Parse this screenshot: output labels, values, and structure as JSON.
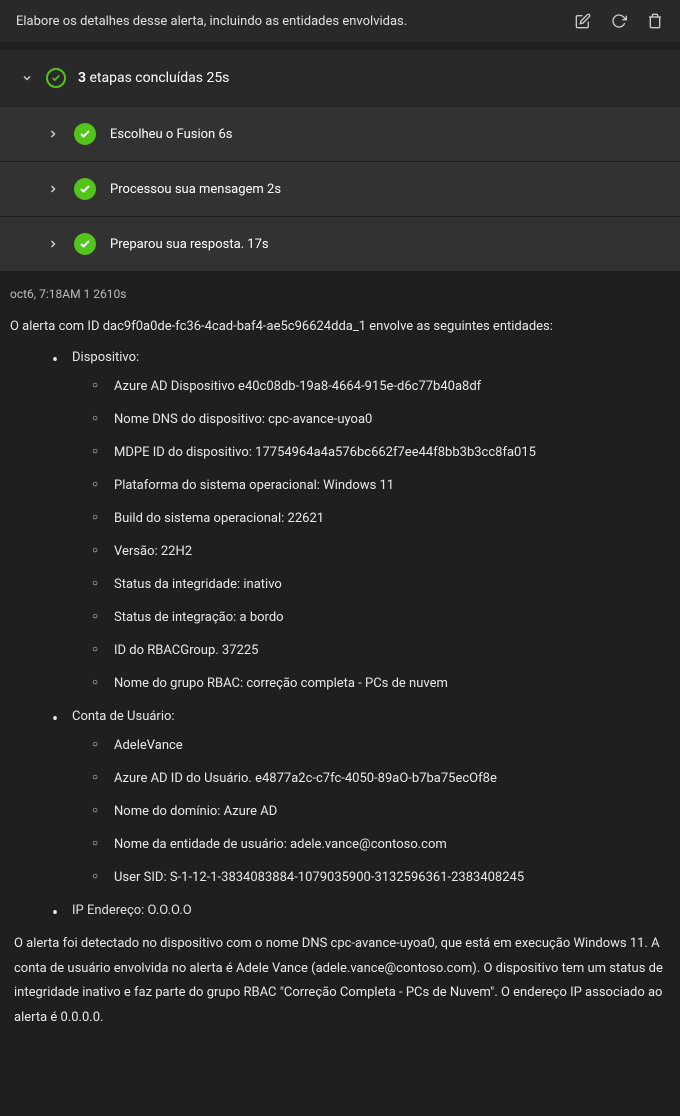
{
  "header": {
    "prompt": "Elabore os detalhes desse alerta, incluindo as entidades envolvidas."
  },
  "steps": {
    "summary_count": "3",
    "summary_label": "etapas concluídas 25s",
    "items": [
      {
        "label": "Escolheu o Fusion 6s"
      },
      {
        "label": "Processou sua mensagem 2s"
      },
      {
        "label": "Preparou sua resposta. 17s"
      }
    ]
  },
  "timestamp": "oct6, 7:18AM 1 2610s",
  "alert_intro": "O alerta com ID dac9f0a0de-fc36-4cad-baf4-ae5c96624dda_1 envolve as seguintes entidades:",
  "device": {
    "title": "Dispositivo:",
    "items": [
      "Azure AD Dispositivo e40c08db-19a8-4664-915e-d6c77b40a8df",
      "Nome DNS do dispositivo: cpc-avance-uyoa0",
      "MDPE ID do dispositivo: 17754964a4a576bc662f7ee44f8bb3b3cc8fa015",
      "Plataforma do sistema operacional: Windows 11",
      "Build do sistema operacional: 22621",
      "Versão: 22H2",
      "Status da integridade: inativo",
      "Status de integração: a bordo",
      "ID do RBACGroup. 37225",
      "Nome do grupo RBAC: correção completa -     PCs de nuvem"
    ]
  },
  "user": {
    "title": "Conta de Usuário:",
    "items": [
      "AdeleVance",
      "Azure AD ID do Usuário. e4877a2c-c7fc-4050-89aO-b7ba75ecOf8e",
      "Nome do domínio: Azure AD",
      "Nome da entidade de usuário: adele.vance@contoso.com",
      "User SID: S-1-12-1-3834083884-1079035900-3132596361-2383408245"
    ]
  },
  "ip": {
    "label": "IP",
    "value": "Endereço: O.O.O.O"
  },
  "footer": "O alerta foi detectado no dispositivo com o nome DNS cpc-avance-uyoa0, que está em execução Windows 11. A conta de usuário envolvida no alerta é Adele Vance (adele.vance@contoso.com). O dispositivo tem um status de integridade inativo e faz parte do grupo RBAC \"Correção Completa - PCs de Nuvem\". O endereço IP associado ao alerta é 0.0.0.0."
}
